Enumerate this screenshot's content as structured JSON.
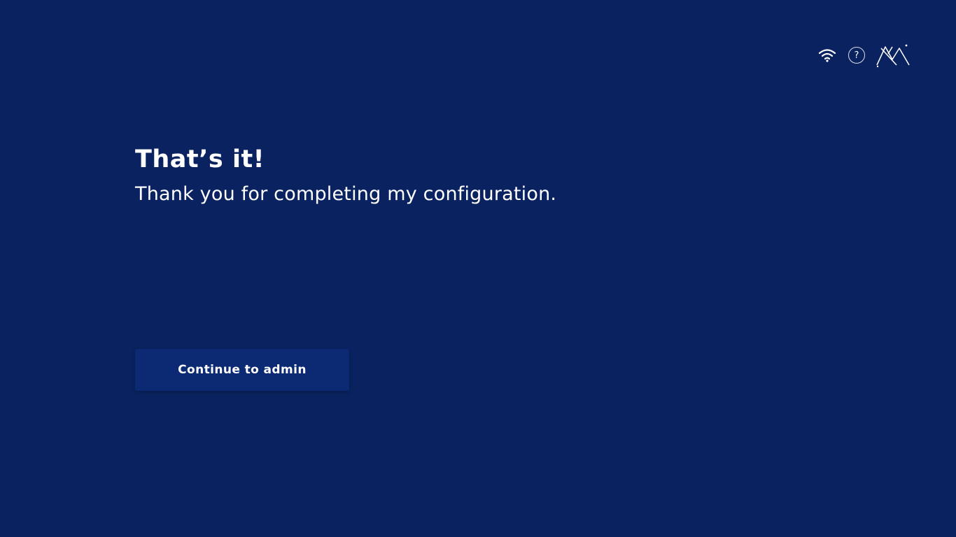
{
  "header": {
    "wifi_icon": "wifi-icon",
    "help_label": "?",
    "logo_icon": "brand-logo-icon"
  },
  "main": {
    "title": "That’s it!",
    "message": "Thank you for completing my configuration."
  },
  "actions": {
    "continue_label": "Continue to admin"
  },
  "colors": {
    "background": "#0a2360",
    "button": "#0c2a73",
    "text": "#ffffff"
  }
}
